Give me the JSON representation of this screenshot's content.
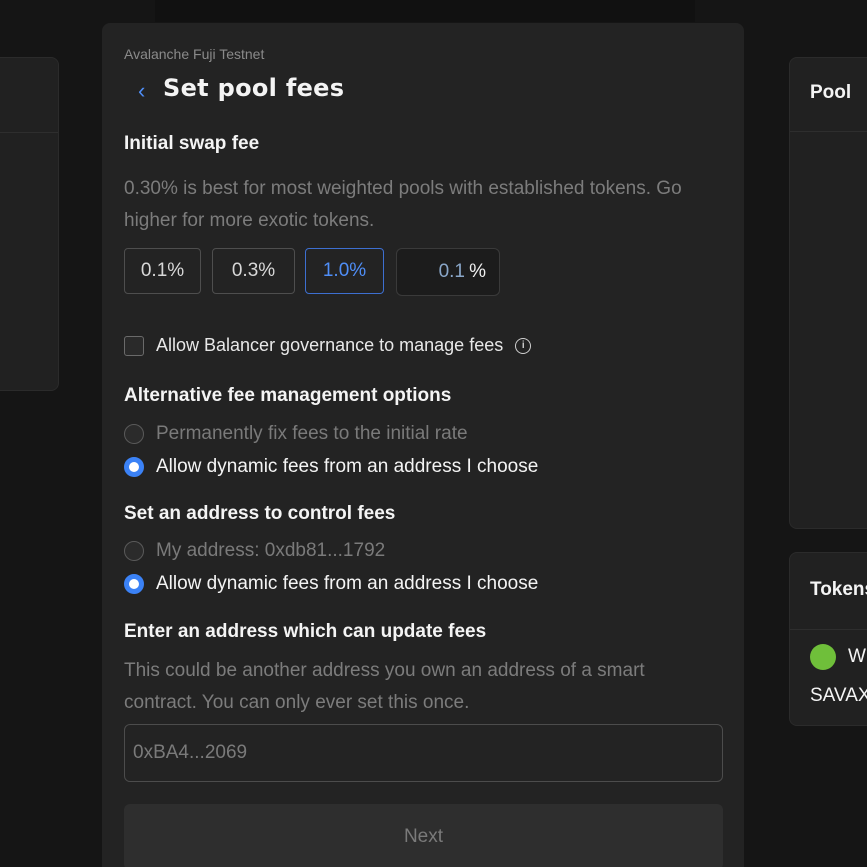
{
  "background_cards": {
    "right_top_header": "Pool",
    "right_bottom_header": "Tokens",
    "token_name": "W",
    "token_symbol": "SAVAX"
  },
  "modal": {
    "network": "Avalanche Fuji Testnet",
    "title": "Set pool fees",
    "initial_swap_fee": {
      "heading": "Initial swap fee",
      "description": "0.30% is best for most weighted pools with established tokens. Go higher for more exotic tokens.",
      "options": [
        "0.1%",
        "0.3%",
        "1.0%"
      ],
      "selected_index": 2,
      "custom_value": "0.1",
      "custom_unit": "%"
    },
    "governance_checkbox": {
      "label": "Allow Balancer governance to manage fees",
      "checked": false
    },
    "alternative": {
      "heading": "Alternative fee management options",
      "options": [
        {
          "label": "Permanently fix fees to the initial rate",
          "selected": false
        },
        {
          "label": "Allow dynamic fees from an address I choose",
          "selected": true
        }
      ]
    },
    "control_address": {
      "heading": "Set an address to control fees",
      "options": [
        {
          "label": "My address: 0xdb81...1792",
          "selected": false
        },
        {
          "label": "Allow dynamic fees from an address I choose",
          "selected": true
        }
      ]
    },
    "update_address": {
      "heading": "Enter an address which can update fees",
      "description": "This could be another address you own an address of a smart contract. You can only ever set this once.",
      "placeholder": "0xBA4...2069"
    },
    "next_label": "Next",
    "colors": {
      "accent": "#3b82f6",
      "surface": "#232323"
    }
  }
}
